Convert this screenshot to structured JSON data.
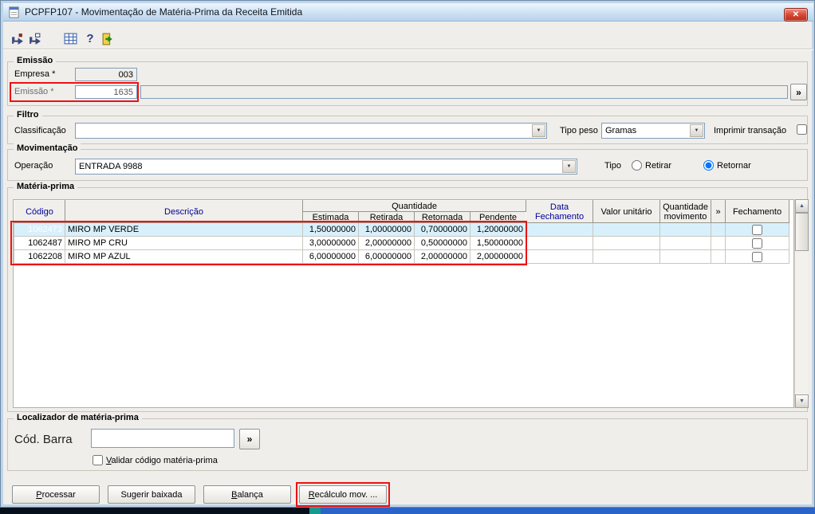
{
  "colors": {
    "annotation": "#ee1111",
    "focused_cell_bg": "#2a61c0",
    "selected_row_bg": "#d8f0fb",
    "grid_header_blue_text": "#00009b",
    "titlebar_top": "#eef6fd",
    "titlebar_bottom": "#b8d2eb",
    "close_button_red": "#d0442c"
  },
  "window": {
    "title": "PCPFP107 - Movimentação de Matéria-Prima da Receita Emitida",
    "close_glyph": "✕"
  },
  "toolbar": {
    "icons": [
      {
        "name": "confirm-icon"
      },
      {
        "name": "confirm-exit-icon"
      },
      {
        "name": "grid-icon"
      },
      {
        "name": "help-icon"
      },
      {
        "name": "exit-icon"
      }
    ]
  },
  "emissao": {
    "legend": "Emissão",
    "empresa_label": "Empresa *",
    "empresa_value": "003",
    "emissao_label": "Emissão *",
    "emissao_value": "1635",
    "descricao_value": "",
    "lookup_button": "»"
  },
  "filtro": {
    "legend": "Filtro",
    "classificacao_label": "Classificação",
    "classificacao_value": "",
    "tipo_peso_label": "Tipo peso",
    "tipo_peso_value": "Gramas",
    "imprimir_label": "Imprimir transação"
  },
  "movimentacao": {
    "legend": "Movimentação",
    "operacao_label": "Operação",
    "operacao_value": "ENTRADA 9988",
    "tipo_label": "Tipo",
    "retirar_label": "Retirar",
    "retornar_label": "Retornar",
    "retornar_checked": "checked"
  },
  "materia_prima": {
    "legend": "Matéria-prima",
    "columns": {
      "codigo": "Código",
      "descricao": "Descrição",
      "quantidade": "Quantidade",
      "estimada": "Estimada",
      "retirada": "Retirada",
      "retornada": "Retornada",
      "pendente": "Pendente",
      "data_fechamento": "Data Fechamento",
      "valor_unitario": "Valor unitário",
      "quantidade_movimento": "Quantidade movimento",
      "expand": "»",
      "fechamento": "Fechamento"
    },
    "rows": [
      {
        "codigo": "1062473",
        "descricao": "MIRO MP VERDE",
        "estimada": "1,50000000",
        "retirada": "1,00000000",
        "retornada": "0,70000000",
        "pendente": "1,20000000",
        "data_fechamento": "",
        "valor_unitario": "",
        "quantidade_movimento": ""
      },
      {
        "codigo": "1062487",
        "descricao": "MIRO MP CRU",
        "estimada": "3,00000000",
        "retirada": "2,00000000",
        "retornada": "0,50000000",
        "pendente": "1,50000000",
        "data_fechamento": "",
        "valor_unitario": "",
        "quantidade_movimento": ""
      },
      {
        "codigo": "1062208",
        "descricao": "MIRO MP AZUL",
        "estimada": "6,00000000",
        "retirada": "6,00000000",
        "retornada": "2,00000000",
        "pendente": "2,00000000",
        "data_fechamento": "",
        "valor_unitario": "",
        "quantidade_movimento": ""
      }
    ]
  },
  "localizador": {
    "legend": "Localizador de matéria-prima",
    "cod_barra_label": "Cód. Barra",
    "cod_barra_value": "",
    "lookup_button": "»",
    "validar_label": "Validar código matéria-prima"
  },
  "actions": {
    "processar": "Processar",
    "sugerir": "Sugerir baixada",
    "balanca": "Balança",
    "recalculo": "Recálculo mov. ..."
  }
}
